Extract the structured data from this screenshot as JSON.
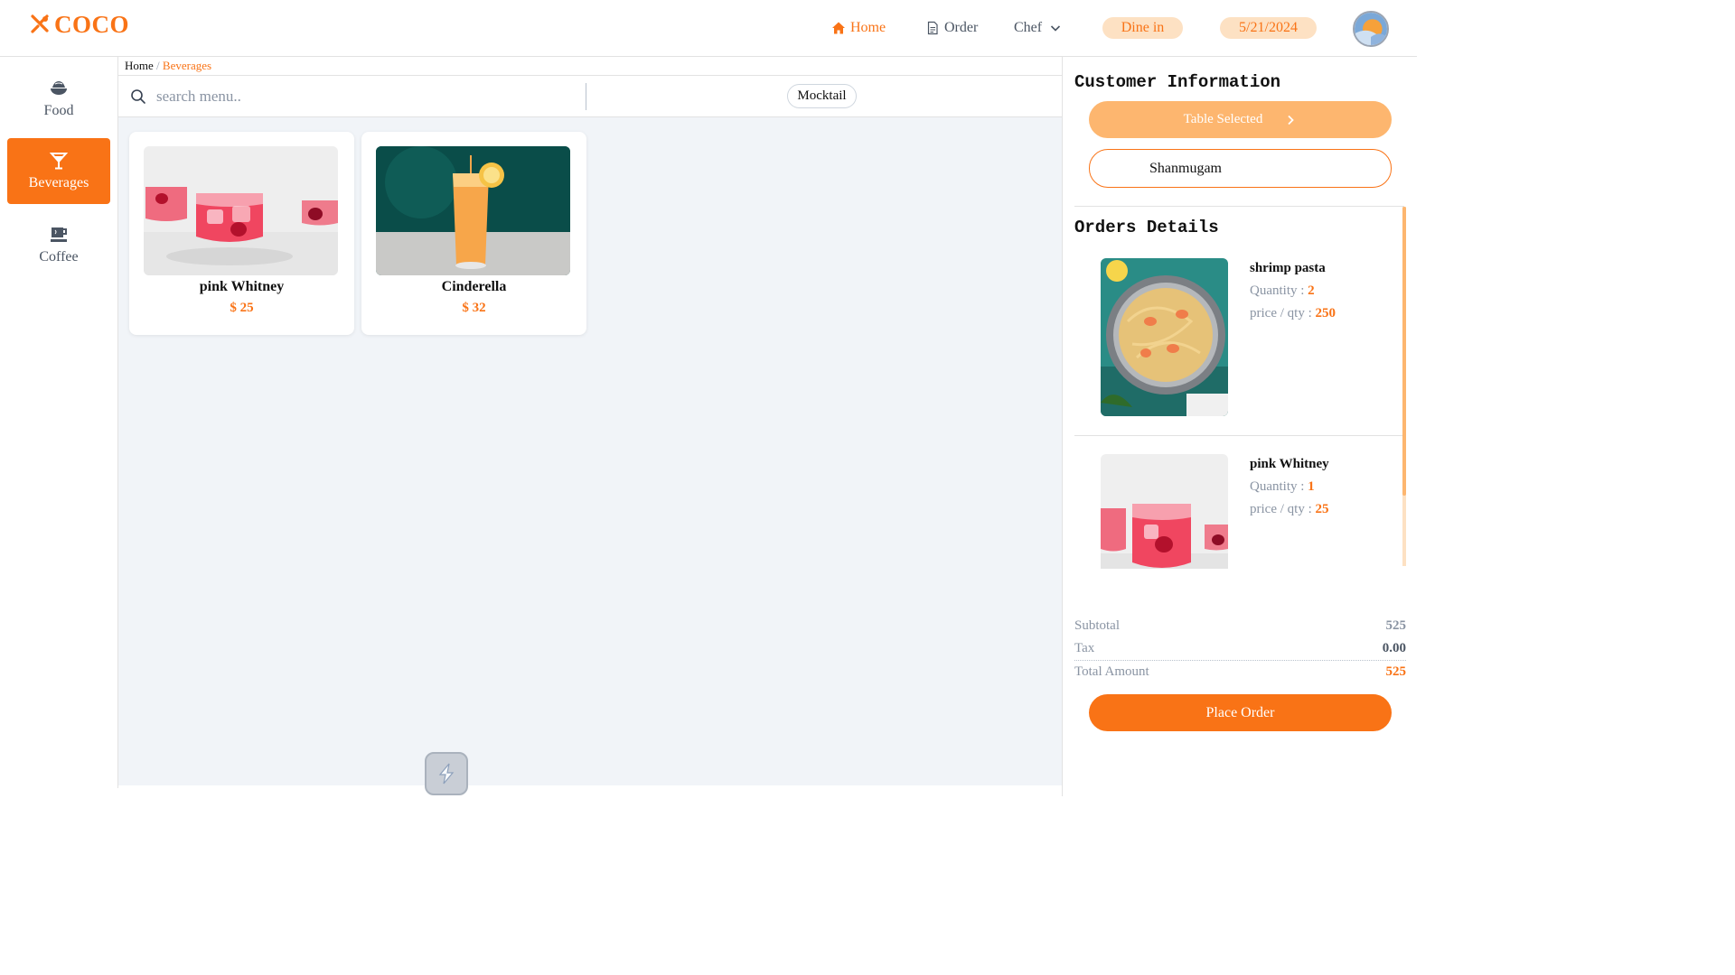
{
  "header": {
    "logo_text": "COCO",
    "logo_icon": "utensils-icon",
    "nav": {
      "home": "Home",
      "order": "Order",
      "chef": "Chef"
    },
    "dine_mode": "Dine in",
    "date": "5/21/2024",
    "accent_color": "#f97316"
  },
  "sidebar": {
    "items": [
      {
        "label": "Food",
        "icon": "bowl-icon"
      },
      {
        "label": "Beverages",
        "icon": "cocktail-icon",
        "active": true
      },
      {
        "label": "Coffee",
        "icon": "coffee-cup-icon"
      }
    ]
  },
  "breadcrumb": {
    "root": "Home",
    "separator": " / ",
    "current": "Beverages"
  },
  "search": {
    "placeholder": "search menu..",
    "value": ""
  },
  "filter_chip": "Mocktail",
  "menu_items": [
    {
      "name": "pink Whitney",
      "price": "$ 25"
    },
    {
      "name": "Cinderella",
      "price": "$ 32"
    }
  ],
  "customer": {
    "title": "Customer Information",
    "table_button": "Table Selected",
    "name_value": "Shanmugam"
  },
  "orders": {
    "title": "Orders Details",
    "quantity_label": "Quantity : ",
    "price_label": "price / qty : ",
    "items": [
      {
        "name": "shrimp pasta",
        "quantity": "2",
        "price": "250"
      },
      {
        "name": "pink Whitney",
        "quantity": "1",
        "price": "25"
      }
    ]
  },
  "totals": {
    "subtotal_label": "Subtotal",
    "subtotal": "525",
    "tax_label": "Tax",
    "tax": "0.00",
    "total_label": "Total Amount",
    "total": "525"
  },
  "place_order": "Place Order"
}
